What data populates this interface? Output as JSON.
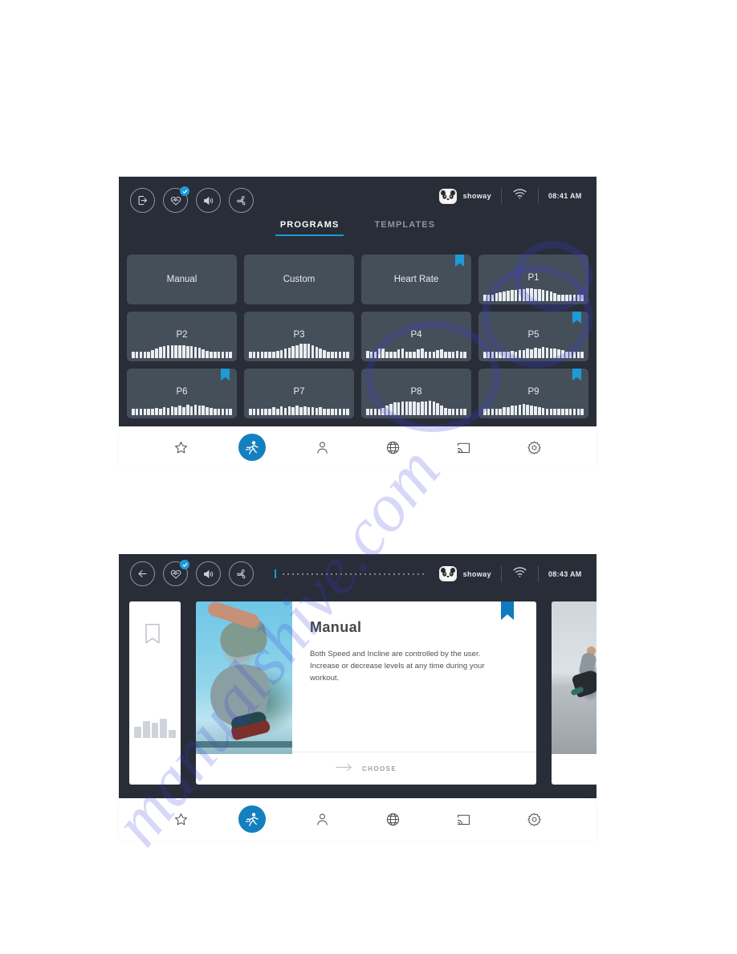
{
  "watermark": {
    "text": "manualshive.com"
  },
  "panel_top": {
    "header": {
      "icons": [
        {
          "name": "exit-icon",
          "label": "Exit"
        },
        {
          "name": "heart-rate-icon",
          "label": "Heart Rate",
          "badge": true
        },
        {
          "name": "volume-icon",
          "label": "Volume"
        },
        {
          "name": "fan-icon",
          "label": "Fan"
        }
      ],
      "username": "showay",
      "time": "08:41 AM",
      "wifi_label": "WiFi connected"
    },
    "tabs": [
      {
        "label": "PROGRAMS",
        "active": true
      },
      {
        "label": "TEMPLATES",
        "active": false
      }
    ],
    "programs": [
      {
        "label": "Manual",
        "bookmarked": false,
        "bars": []
      },
      {
        "label": "Custom",
        "bookmarked": false,
        "bars": []
      },
      {
        "label": "Heart Rate",
        "bookmarked": true,
        "bars": []
      },
      {
        "label": "P1",
        "bookmarked": false,
        "bars": [
          10,
          12,
          30,
          48,
          55,
          62,
          66,
          70,
          72,
          74,
          76,
          78,
          78,
          76,
          74,
          70,
          66,
          60,
          52,
          40,
          26,
          18,
          14,
          12,
          14,
          16
        ]
      },
      {
        "label": "P2",
        "bookmarked": false,
        "bars": [
          14,
          18,
          26,
          34,
          42,
          52,
          62,
          70,
          76,
          80,
          82,
          82,
          80,
          78,
          76,
          74,
          70,
          64,
          56,
          46,
          34,
          24,
          18,
          14,
          12,
          12
        ]
      },
      {
        "label": "P3",
        "bookmarked": false,
        "bars": [
          10,
          12,
          16,
          22,
          28,
          34,
          40,
          46,
          52,
          58,
          66,
          74,
          82,
          88,
          92,
          88,
          80,
          70,
          60,
          48,
          36,
          26,
          20,
          16,
          14,
          12
        ]
      },
      {
        "label": "P4",
        "bookmarked": false,
        "bars": [
          44,
          16,
          14,
          58,
          62,
          20,
          18,
          16,
          56,
          60,
          30,
          22,
          18,
          54,
          58,
          26,
          20,
          18,
          52,
          56,
          24,
          20,
          42,
          46,
          22,
          34
        ]
      },
      {
        "label": "P5",
        "bookmarked": true,
        "bars": [
          18,
          24,
          22,
          30,
          28,
          36,
          34,
          44,
          42,
          52,
          48,
          58,
          54,
          64,
          60,
          70,
          66,
          62,
          58,
          54,
          48,
          42,
          36,
          30,
          24,
          18
        ]
      },
      {
        "label": "P6",
        "bookmarked": true,
        "bars": [
          14,
          20,
          34,
          28,
          40,
          34,
          46,
          40,
          52,
          44,
          56,
          48,
          60,
          52,
          64,
          56,
          66,
          58,
          60,
          52,
          46,
          38,
          30,
          24,
          18,
          14
        ]
      },
      {
        "label": "P7",
        "bookmarked": false,
        "bars": [
          16,
          22,
          36,
          30,
          42,
          36,
          48,
          42,
          54,
          46,
          56,
          50,
          58,
          50,
          56,
          48,
          52,
          44,
          48,
          40,
          42,
          34,
          30,
          24,
          20,
          16
        ]
      },
      {
        "label": "P8",
        "bookmarked": false,
        "bars": [
          8,
          10,
          14,
          22,
          46,
          62,
          72,
          78,
          82,
          84,
          86,
          86,
          84,
          80,
          84,
          86,
          88,
          84,
          76,
          62,
          44,
          30,
          22,
          16,
          12,
          10
        ]
      },
      {
        "label": "P9",
        "bookmarked": true,
        "bars": [
          10,
          16,
          26,
          34,
          40,
          48,
          52,
          58,
          62,
          66,
          70,
          66,
          62,
          56,
          50,
          44,
          40,
          36,
          32,
          28,
          24,
          20,
          18,
          16,
          14,
          12
        ]
      }
    ],
    "bottom_nav": [
      {
        "name": "favorites",
        "icon": "star-icon",
        "active": false
      },
      {
        "name": "workout",
        "icon": "runner-icon",
        "active": true
      },
      {
        "name": "profile",
        "icon": "person-icon",
        "active": false
      },
      {
        "name": "internet",
        "icon": "globe-icon",
        "active": false
      },
      {
        "name": "cast",
        "icon": "cast-icon",
        "active": false
      },
      {
        "name": "settings",
        "icon": "gear-icon",
        "active": false
      }
    ]
  },
  "panel_bottom": {
    "header": {
      "icons": [
        {
          "name": "back-icon",
          "label": "Back"
        },
        {
          "name": "heart-rate-icon",
          "label": "Heart Rate",
          "badge": true
        },
        {
          "name": "volume-icon",
          "label": "Volume"
        },
        {
          "name": "fan-icon",
          "label": "Fan"
        }
      ],
      "username": "showay",
      "time": "08:43 AM",
      "progress_dots": 30
    },
    "detail": {
      "title": "Manual",
      "description": "Both Speed and Incline are controlled by the user. Increase or decrease levels at any time during your workout.",
      "bookmarked": true,
      "choose_label": "CHOOSE",
      "side_left": {
        "bookmarked": false,
        "bars": [
          48,
          70,
          62,
          80,
          34
        ]
      },
      "photo_main_alt": "athlete jumping",
      "photo_right_alt": "woman running outdoors"
    },
    "bottom_nav": [
      {
        "name": "favorites",
        "icon": "star-icon",
        "active": false
      },
      {
        "name": "workout",
        "icon": "runner-icon",
        "active": true
      },
      {
        "name": "profile",
        "icon": "person-icon",
        "active": false
      },
      {
        "name": "internet",
        "icon": "globe-icon",
        "active": false
      },
      {
        "name": "cast",
        "icon": "cast-icon",
        "active": false
      },
      {
        "name": "settings",
        "icon": "gear-icon",
        "active": false
      }
    ]
  },
  "colors": {
    "header_bg": "#282d38",
    "card_bg": "#454f59",
    "accent": "#1e9ad6",
    "accent_dark": "#1079bf",
    "text_light": "#e6eaee",
    "text_muted": "#8e96a3"
  }
}
